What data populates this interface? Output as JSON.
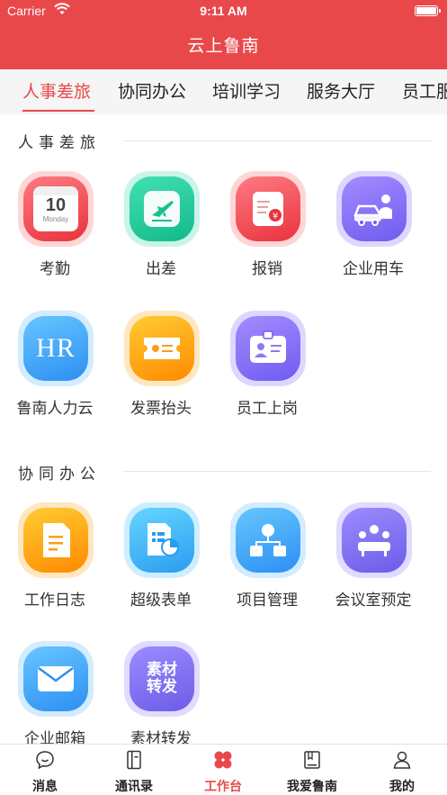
{
  "status_bar": {
    "carrier": "Carrier",
    "time": "9:11 AM"
  },
  "header": {
    "title": "云上鲁南"
  },
  "tabs": [
    {
      "label": "人事差旅",
      "active": true
    },
    {
      "label": "协同办公",
      "active": false
    },
    {
      "label": "培训学习",
      "active": false
    },
    {
      "label": "服务大厅",
      "active": false
    },
    {
      "label": "员工服",
      "active": false
    }
  ],
  "sections": [
    {
      "title": "人事差旅",
      "items": [
        {
          "label": "考勤",
          "icon": "calendar-icon",
          "color": "red",
          "calendar_number": "10",
          "calendar_day": "Monday"
        },
        {
          "label": "出差",
          "icon": "airplane-icon",
          "color": "green"
        },
        {
          "label": "报销",
          "icon": "receipt-money-icon",
          "color": "red"
        },
        {
          "label": "企业用车",
          "icon": "car-person-icon",
          "color": "purple"
        },
        {
          "label": "鲁南人力云",
          "icon": "hr-logo-icon",
          "color": "blue",
          "icon_text": "HR"
        },
        {
          "label": "发票抬头",
          "icon": "ticket-icon",
          "color": "orange"
        },
        {
          "label": "员工上岗",
          "icon": "id-badge-icon",
          "color": "purple"
        }
      ]
    },
    {
      "title": "协同办公",
      "items": [
        {
          "label": "工作日志",
          "icon": "document-icon",
          "color": "orange"
        },
        {
          "label": "超级表单",
          "icon": "form-chart-icon",
          "color": "cyan"
        },
        {
          "label": "项目管理",
          "icon": "org-chart-icon",
          "color": "blue"
        },
        {
          "label": "会议室预定",
          "icon": "meeting-icon",
          "color": "violet"
        },
        {
          "label": "企业邮箱",
          "icon": "mail-icon",
          "color": "blue"
        },
        {
          "label": "素材转发",
          "icon": "material-forward-icon",
          "color": "violet",
          "icon_text_1": "素材",
          "icon_text_2": "转发"
        }
      ]
    }
  ],
  "bottom_nav": [
    {
      "label": "消息",
      "icon": "chat-bubble-icon",
      "active": false
    },
    {
      "label": "通讯录",
      "icon": "contacts-book-icon",
      "active": false
    },
    {
      "label": "工作台",
      "icon": "workbench-icon",
      "active": true
    },
    {
      "label": "我爱鲁南",
      "icon": "book-icon",
      "active": false
    },
    {
      "label": "我的",
      "icon": "person-icon",
      "active": false
    }
  ],
  "colors": {
    "brand_red": "#e9484b",
    "tab_bg": "#f5f5f5"
  }
}
